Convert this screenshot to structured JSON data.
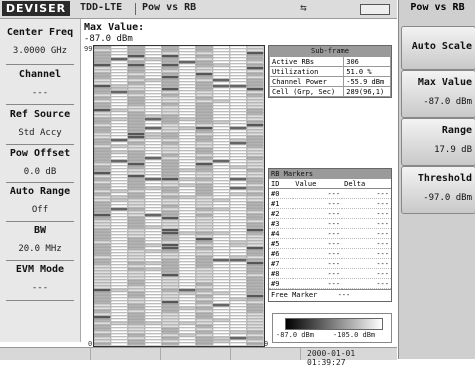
{
  "header": {
    "logo": "DEVISER",
    "mode": "TDD-LTE",
    "measurement": "Pow vs RB",
    "usb_icon": "usb-icon",
    "battery_icon": "battery-icon"
  },
  "left_panel": [
    {
      "label": "Center Freq",
      "value": "3.0000 GHz"
    },
    {
      "label": "Channel",
      "value": "---"
    },
    {
      "label": "Ref Source",
      "value": "Std Accy"
    },
    {
      "label": "Pow Offset",
      "value": "0.0 dB"
    },
    {
      "label": "Auto Range",
      "value": "Off"
    },
    {
      "label": "BW",
      "value": "20.0 MHz"
    },
    {
      "label": "EVM Mode",
      "value": "---"
    }
  ],
  "plot": {
    "max_label": "Max Value:",
    "max_value": "-87.0 dBm",
    "y_top": "99",
    "y_bottom": "0",
    "x_right": "9"
  },
  "subframe": {
    "title": "Sub-frame",
    "rows": [
      {
        "k": "Active RBs",
        "v": "306"
      },
      {
        "k": "Utilization",
        "v": "51.0 %"
      },
      {
        "k": "Channel Power",
        "v": "-55.9 dBm"
      },
      {
        "k": "Cell (Grp, Sec)",
        "v": "289(96,1)"
      }
    ]
  },
  "markers": {
    "title": "RB Markers",
    "col_id": "ID",
    "col_value": "Value",
    "col_delta": "Delta",
    "rows": [
      {
        "id": "#0",
        "value": "---",
        "delta": "---"
      },
      {
        "id": "#1",
        "value": "---",
        "delta": "---"
      },
      {
        "id": "#2",
        "value": "---",
        "delta": "---"
      },
      {
        "id": "#3",
        "value": "---",
        "delta": "---"
      },
      {
        "id": "#4",
        "value": "---",
        "delta": "---"
      },
      {
        "id": "#5",
        "value": "---",
        "delta": "---"
      },
      {
        "id": "#6",
        "value": "---",
        "delta": "---"
      },
      {
        "id": "#7",
        "value": "---",
        "delta": "---"
      },
      {
        "id": "#8",
        "value": "---",
        "delta": "---"
      },
      {
        "id": "#9",
        "value": "---",
        "delta": "---"
      }
    ],
    "free_label": "Free Marker",
    "free_value": "---"
  },
  "legend": {
    "left": "-87.0 dBm",
    "right": "-105.0 dBm"
  },
  "status": {
    "datetime": "2000-01-01 01:39:27"
  },
  "softkeys": {
    "title": "Pow vs RB",
    "auto_scale": "Auto Scale",
    "max_value_label": "Max Value",
    "max_value": "-87.0 dBm",
    "range_label": "Range",
    "range_value": "17.9 dB",
    "threshold_label": "Threshold",
    "threshold_value": "-97.0 dBm"
  },
  "colors": {
    "heat_dark": "#000000",
    "heat_mid": "#a8a8a8",
    "heat_light": "#ffffff"
  }
}
